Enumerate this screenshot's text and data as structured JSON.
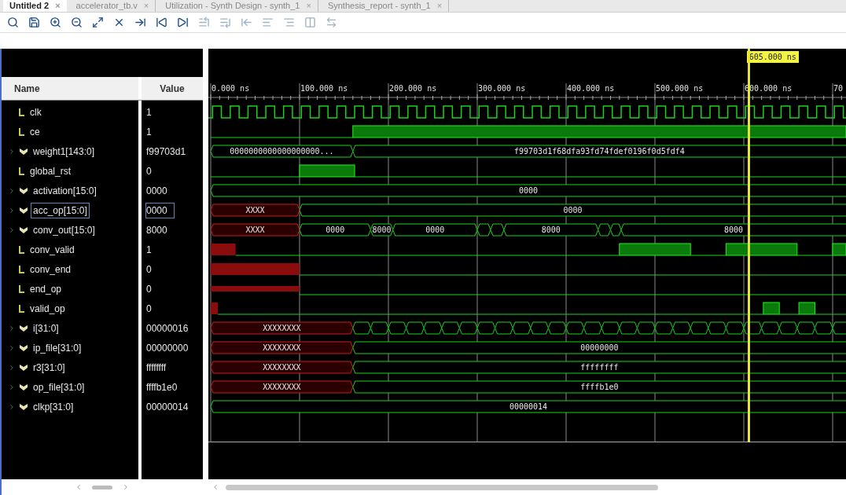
{
  "tabs": [
    {
      "label": "Untitled 2",
      "close": "×",
      "selected": true
    },
    {
      "label": "accelerator_tb.v",
      "close": "×",
      "selected": false
    },
    {
      "label": "Utilization - Synth Design - synth_1",
      "close": "×",
      "selected": false
    },
    {
      "label": "Synthesis_report - synth_1",
      "close": "×",
      "selected": false
    }
  ],
  "columns": {
    "name": "Name",
    "value": "Value"
  },
  "ruler": {
    "labels": [
      "0.000 ns",
      "100.000 ns",
      "200.000 ns",
      "300.000 ns",
      "400.000 ns",
      "500.000 ns",
      "600.000 ns",
      "70"
    ],
    "cursor": "605.000 ns"
  },
  "signals": [
    {
      "name": "clk",
      "value": "1",
      "kind": "bit",
      "selected": false
    },
    {
      "name": "ce",
      "value": "1",
      "kind": "bit",
      "selected": false
    },
    {
      "name": "weight1[143:0]",
      "value": "f99703d1",
      "kind": "bus",
      "selected": false,
      "wave_labels": [
        "0000000000000000000...",
        "f99703d1f68dfa93fd74fdef0196f0d5fdf4"
      ]
    },
    {
      "name": "global_rst",
      "value": "0",
      "kind": "bit",
      "selected": false
    },
    {
      "name": "activation[15:0]",
      "value": "0000",
      "kind": "bus",
      "selected": false,
      "wave_labels": [
        "0000"
      ]
    },
    {
      "name": "acc_op[15:0]",
      "value": "0000",
      "kind": "bus",
      "selected": true,
      "wave_labels": [
        "XXXX",
        "0000"
      ]
    },
    {
      "name": "conv_out[15:0]",
      "value": "8000",
      "kind": "bus",
      "selected": false,
      "wave_labels": [
        "XXXX",
        "0000",
        "8000",
        "0000",
        "8000",
        "8000"
      ]
    },
    {
      "name": "conv_valid",
      "value": "1",
      "kind": "bit",
      "selected": false
    },
    {
      "name": "conv_end",
      "value": "0",
      "kind": "bit",
      "selected": false
    },
    {
      "name": "end_op",
      "value": "0",
      "kind": "bit",
      "selected": false
    },
    {
      "name": "valid_op",
      "value": "0",
      "kind": "bit",
      "selected": false
    },
    {
      "name": "i[31:0]",
      "value": "00000016",
      "kind": "bus",
      "selected": false,
      "wave_labels": [
        "XXXXXXXX"
      ]
    },
    {
      "name": "ip_file[31:0]",
      "value": "00000000",
      "kind": "bus",
      "selected": false,
      "wave_labels": [
        "XXXXXXXX",
        "00000000"
      ]
    },
    {
      "name": "r3[31:0]",
      "value": "ffffffff",
      "kind": "bus",
      "selected": false,
      "wave_labels": [
        "XXXXXXXX",
        "ffffffff"
      ]
    },
    {
      "name": "op_file[31:0]",
      "value": "ffffb1e0",
      "kind": "bus",
      "selected": false,
      "wave_labels": [
        "XXXXXXXX",
        "ffffb1e0"
      ]
    },
    {
      "name": "clkp[31:0]",
      "value": "00000014",
      "kind": "bus",
      "selected": false,
      "wave_labels": [
        "00000014"
      ]
    }
  ]
}
